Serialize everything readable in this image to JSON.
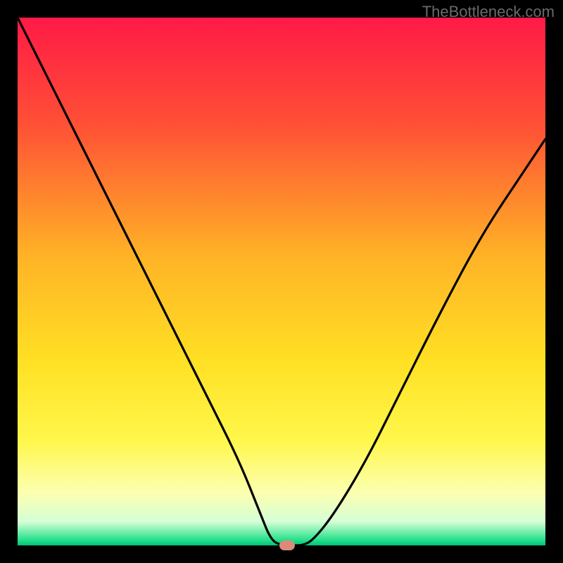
{
  "watermark": "TheBottleneck.com",
  "chart_data": {
    "type": "line",
    "title": "",
    "xlabel": "",
    "ylabel": "",
    "xlim": [
      0,
      100
    ],
    "ylim": [
      0,
      100
    ],
    "grid": false,
    "series": [
      {
        "name": "bottleneck-curve",
        "x": [
          0,
          6,
          12,
          18,
          24,
          30,
          36,
          42,
          46,
          48,
          50,
          52,
          54,
          56,
          60,
          66,
          72,
          80,
          88,
          96,
          100
        ],
        "y": [
          100,
          88,
          76,
          64,
          52,
          40,
          28,
          16,
          6,
          1,
          0,
          0,
          0,
          1,
          6,
          16,
          28,
          44,
          59,
          71,
          77
        ]
      }
    ],
    "minimum_marker": {
      "x": 51,
      "y": 0,
      "color": "#db8a7a"
    },
    "background_gradient": {
      "type": "linear-vertical",
      "stops": [
        {
          "offset": 0.0,
          "color": "#ff1a46"
        },
        {
          "offset": 0.2,
          "color": "#ff4f36"
        },
        {
          "offset": 0.45,
          "color": "#ffb226"
        },
        {
          "offset": 0.65,
          "color": "#ffe024"
        },
        {
          "offset": 0.8,
          "color": "#fff74a"
        },
        {
          "offset": 0.9,
          "color": "#fcffb0"
        },
        {
          "offset": 0.955,
          "color": "#d6ffd6"
        },
        {
          "offset": 0.99,
          "color": "#24e08a"
        },
        {
          "offset": 1.0,
          "color": "#00c37a"
        }
      ]
    }
  },
  "colors": {
    "curve": "#000000",
    "marker": "#db8a7a",
    "frame": "#000000"
  }
}
